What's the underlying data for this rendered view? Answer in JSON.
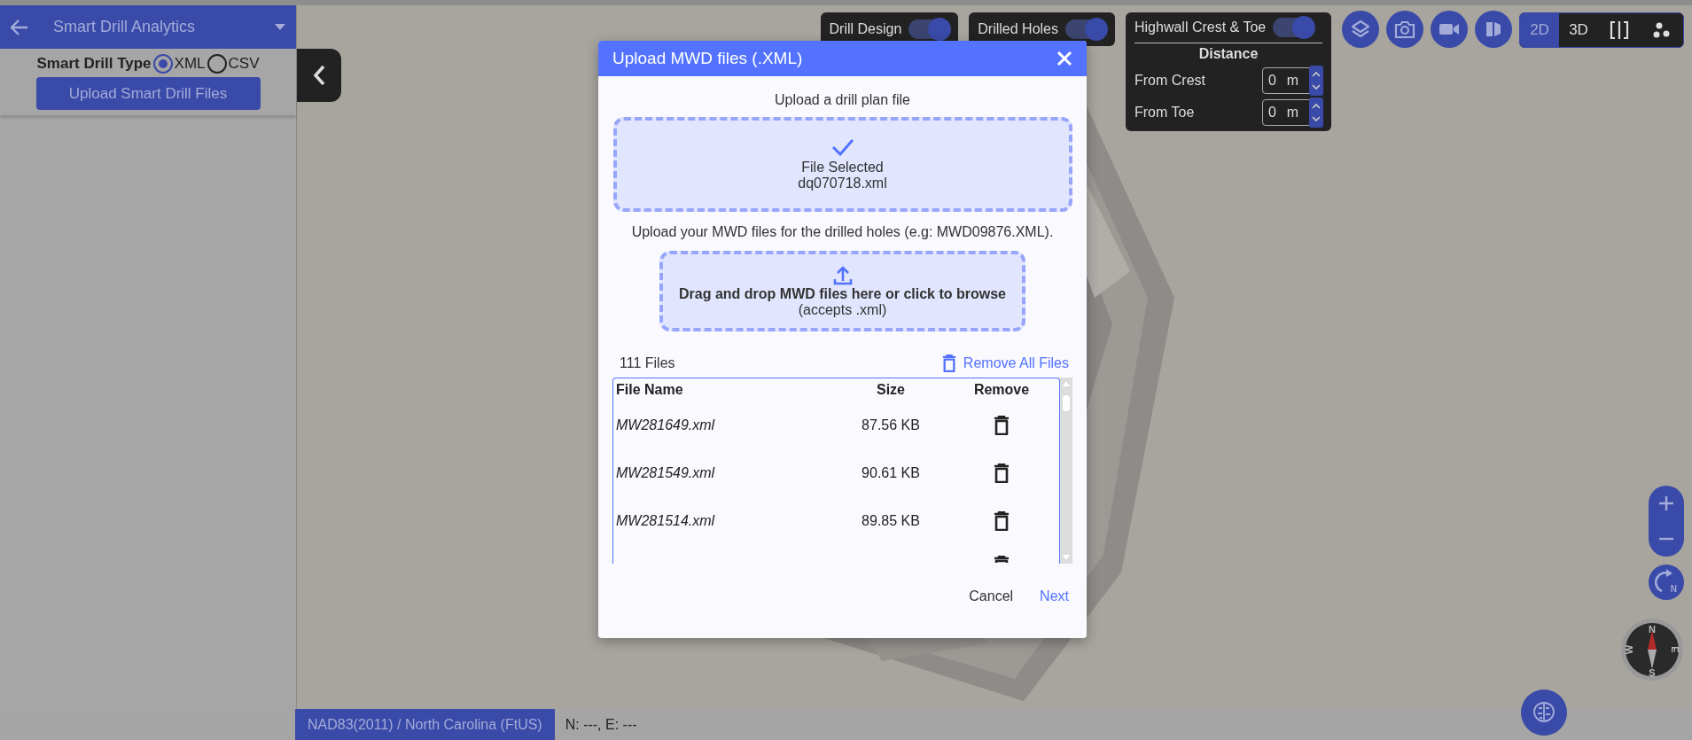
{
  "sidebar": {
    "title": "Smart Drill Analytics",
    "type_label": "Smart Drill Type",
    "types": [
      {
        "label": "XML",
        "selected": true
      },
      {
        "label": "CSV",
        "selected": false
      }
    ],
    "upload_button": "Upload Smart Drill Files"
  },
  "layer_toggles": [
    {
      "label": "Drill Design",
      "on": true
    },
    {
      "label": "Drilled Holes",
      "on": true
    }
  ],
  "highwall": {
    "label": "Highwall Crest & Toe",
    "on": true,
    "heading": "Distance",
    "fields": [
      {
        "label": "From Crest",
        "value": "0",
        "unit": "m"
      },
      {
        "label": "From Toe",
        "value": "0",
        "unit": "m"
      }
    ]
  },
  "view_modes": [
    {
      "label": "2D",
      "selected": true
    },
    {
      "label": "3D",
      "selected": false
    }
  ],
  "rotate_label": "N",
  "compass": {
    "north": "N",
    "east": "E",
    "south": "S",
    "west": "W"
  },
  "dialog": {
    "title": "Upload MWD files (.XML)",
    "plan_label": "Upload a drill plan file",
    "plan_status": "File Selected",
    "plan_file": "dq070718.xml",
    "mwd_label": "Upload your MWD files for the drilled holes (e.g: MWD09876.XML).",
    "drop_text": "Drag and drop MWD files here or click to browse",
    "drop_hint": "(accepts .xml)",
    "file_count": "111 Files",
    "remove_all": "Remove All Files",
    "columns": [
      "File Name",
      "Size",
      "Remove"
    ],
    "files": [
      {
        "name": "MW281649.xml",
        "size": "87.56 KB"
      },
      {
        "name": "MW281549.xml",
        "size": "90.61 KB"
      },
      {
        "name": "MW281514.xml",
        "size": "89.85 KB"
      }
    ],
    "buttons": [
      {
        "label": "Cancel",
        "kind": "secondary"
      },
      {
        "label": "Next",
        "kind": "primary"
      }
    ]
  },
  "status_bar": {
    "crs": "NAD83(2011) / North Carolina (FtUS)",
    "coords": "N: ---, E: ---"
  }
}
